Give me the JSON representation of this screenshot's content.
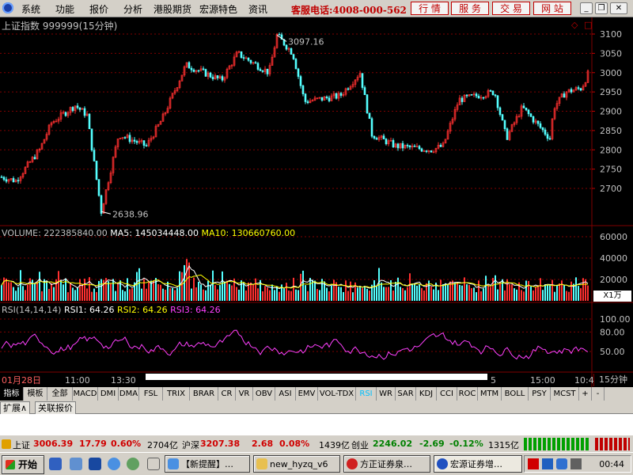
{
  "menu": {
    "items": [
      "系统",
      "功能",
      "报价",
      "分析",
      "港股期货",
      "宏源特色",
      "资讯"
    ],
    "hotline": "客服电话:4008-000-562",
    "buttons": [
      "行 情",
      "服 务",
      "交 易",
      "网 站"
    ]
  },
  "chart": {
    "title": "上证指数",
    "code": "999999(15分钟)",
    "price_high_label": "3097.16",
    "price_low_label": "2638.96",
    "price_axis": [
      "3100",
      "3050",
      "3000",
      "2950",
      "2900",
      "2850",
      "2800",
      "2750",
      "2700"
    ],
    "volume_label": "VOLUME: 222385840.00",
    "ma5_label": "MA5: 145034448.00",
    "ma10_label": "MA10: 130660760.00",
    "volume_axis": [
      "60000",
      "40000",
      "20000"
    ],
    "volume_unit": "X1万",
    "rsi_label": "RSI(14,14,14)",
    "rsi1_label": "RSI1: 64.26",
    "rsi2_label": "RSI2: 64.26",
    "rsi3_label": "RSI3: 64.26",
    "rsi_axis": [
      "100.00",
      "80.00",
      "50.00"
    ],
    "time_axis": [
      "01月28日",
      "11:00",
      "13:30",
      "5",
      "15:00",
      "10:4"
    ],
    "period": "15分钟",
    "colors": {
      "up": "#ff3030",
      "down": "#54ffff",
      "ma5": "#ffffff",
      "ma10": "#ffff00",
      "rsi3": "#ff40ff",
      "grid": "#800000"
    }
  },
  "indicator_tabs": [
    "指标",
    "模板",
    "全部",
    "MACD",
    "DMI",
    "DMA",
    "FSL",
    "TRIX",
    "BRAR",
    "CR",
    "VR",
    "OBV",
    "ASI",
    "EMV",
    "VOL-TDX",
    "RSI",
    "WR",
    "SAR",
    "KDJ",
    "CCI",
    "ROC",
    "MTM",
    "BOLL",
    "PSY",
    "MCST",
    "+",
    "-"
  ],
  "sub_tabs": [
    "扩展∧",
    "关联报价"
  ],
  "status": {
    "sh_label": "上证",
    "sh_value": "3006.39",
    "sh_change": "17.79",
    "sh_pct": "0.60%",
    "sh_amount": "2704亿",
    "hs_label": "沪深",
    "hs_value": "3207.38",
    "hs_change": "2.68",
    "hs_pct": "0.08%",
    "hs_amount": "1439亿",
    "cy_label": "创业",
    "cy_value": "2246.02",
    "cy_change": "-2.69",
    "cy_pct": "-0.12%",
    "cy_amount": "1315亿"
  },
  "taskbar": {
    "start": "开始",
    "tasks": [
      "【新提醒】…",
      "new_hyzq_v6",
      "方正证券泉…",
      "宏源证券增…"
    ],
    "clock": "00:44"
  }
}
